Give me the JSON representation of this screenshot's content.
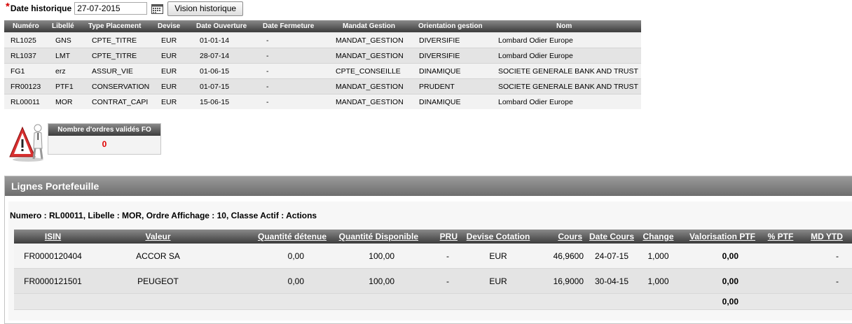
{
  "date_bar": {
    "required_marker": "*",
    "label": "Date historique",
    "date_value": "27-07-2015",
    "calendar_icon": "calendar-icon",
    "button_label": "Vision historique"
  },
  "accounts": {
    "columns": [
      "Numéro",
      "Libellé",
      "Type Placement",
      "Devise",
      "Date Ouverture",
      "Date Fermeture",
      "Mandat Gestion",
      "Orientation gestion",
      "Nom"
    ],
    "rows": [
      [
        "RL1025",
        "GNS",
        "CPTE_TITRE",
        "EUR",
        "01-01-14",
        "-",
        "MANDAT_GESTION",
        "DIVERSIFIE",
        "Lombard Odier Europe"
      ],
      [
        "RL1037",
        "LMT",
        "CPTE_TITRE",
        "EUR",
        "28-07-14",
        "-",
        "MANDAT_GESTION",
        "DIVERSIFIE",
        "Lombard Odier Europe"
      ],
      [
        "FG1",
        "erz",
        "ASSUR_VIE",
        "EUR",
        "01-06-15",
        "-",
        "CPTE_CONSEILLE",
        "DINAMIQUE",
        "SOCIETE GENERALE BANK AND TRUST"
      ],
      [
        "FR00123",
        "PTF1",
        "CONSERVATION",
        "EUR",
        "01-07-15",
        "-",
        "MANDAT_GESTION",
        "PRUDENT",
        "SOCIETE GENERALE BANK AND TRUST"
      ],
      [
        "RL00011",
        "MOR",
        "CONTRAT_CAPI",
        "EUR",
        "15-06-15",
        "-",
        "MANDAT_GESTION",
        "DINAMIQUE",
        "Lombard Odier Europe"
      ]
    ]
  },
  "orders": {
    "warning_icon": "warning-icon",
    "title": "Nombre d'ordres validés FO",
    "value": "0",
    "value_color": "#e00000"
  },
  "portfolio": {
    "panel_title": "Lignes Portefeuille",
    "info_line": "Numero : RL00011, Libelle : MOR, Ordre Affichage : 10, Classe Actif : Actions",
    "columns": [
      "ISIN",
      "Valeur",
      "Quantité détenue",
      "Quantité Disponible",
      "PRU",
      "Devise Cotation",
      "Cours",
      "Date Cours",
      "Change",
      "Valorisation PTF",
      "% PTF",
      "MD YTD"
    ],
    "rows": [
      [
        "FR0000120404",
        "ACCOR SA",
        "0,00",
        "100,00",
        "-",
        "EUR",
        "46,9600",
        "24-07-15",
        "1,000",
        "0,00",
        "",
        "-"
      ],
      [
        "FR0000121501",
        "PEUGEOT",
        "0,00",
        "100,00",
        "-",
        "EUR",
        "16,9000",
        "30-04-15",
        "1,000",
        "0,00",
        "",
        "-"
      ]
    ],
    "total_valorisation": "0,00"
  },
  "colors": {
    "header_dark": "#3c3c3c",
    "required_red": "#d40000"
  }
}
